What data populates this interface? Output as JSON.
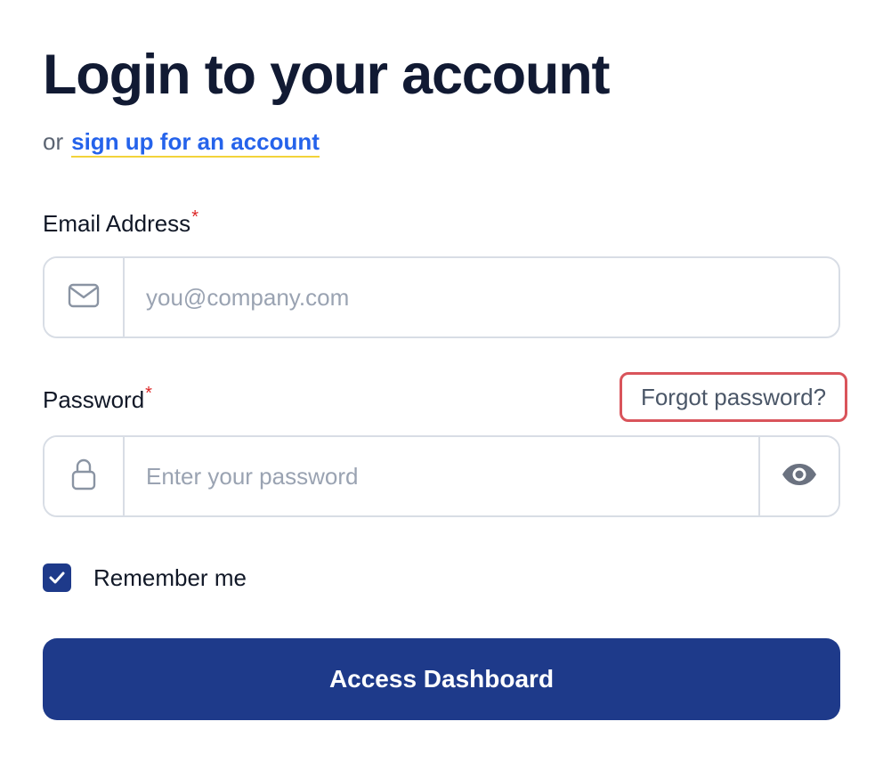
{
  "header": {
    "title": "Login to your account",
    "subtitle_prefix": "or",
    "signup_link": "sign up for an account"
  },
  "form": {
    "email": {
      "label": "Email Address",
      "required_mark": "*",
      "value": "",
      "placeholder": "you@company.com",
      "icon": "envelope-icon"
    },
    "password": {
      "label": "Password",
      "required_mark": "*",
      "value": "",
      "placeholder": "Enter your password",
      "icon": "lock-icon",
      "toggle_icon": "eye-icon",
      "forgot_link": "Forgot password?"
    },
    "remember": {
      "label": "Remember me",
      "checked": true
    },
    "submit_label": "Access Dashboard"
  },
  "colors": {
    "primary": "#1e3a8a",
    "link": "#2563eb",
    "link_underline": "#f2d33a",
    "required": "#dc2626",
    "highlight_border": "#d9545b"
  }
}
